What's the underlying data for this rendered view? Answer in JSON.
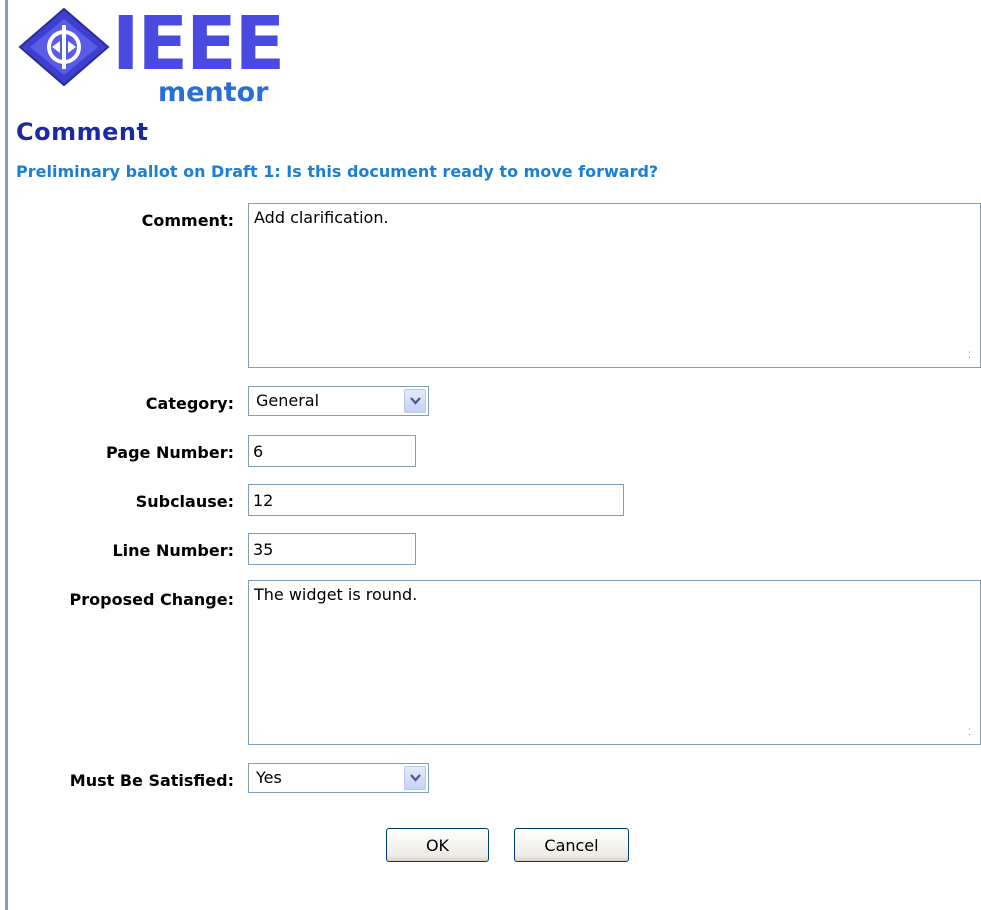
{
  "logo": {
    "brand": "IEEE",
    "product": "mentor"
  },
  "page": {
    "title": "Comment",
    "subtitle": "Preliminary ballot on Draft 1: Is this document ready to move forward?"
  },
  "form": {
    "comment": {
      "label": "Comment:",
      "value": "Add clarification."
    },
    "category": {
      "label": "Category:",
      "value": "General"
    },
    "page_number": {
      "label": "Page Number:",
      "value": "6"
    },
    "subclause": {
      "label": "Subclause:",
      "value": "12"
    },
    "line_number": {
      "label": "Line Number:",
      "value": "35"
    },
    "proposed_change": {
      "label": "Proposed Change:",
      "value": "The widget is round."
    },
    "must_be_satisfied": {
      "label": "Must Be Satisfied:",
      "value": "Yes"
    }
  },
  "buttons": {
    "ok": "OK",
    "cancel": "Cancel"
  },
  "colors": {
    "heading": "#1d2a9e",
    "subheading": "#1b7fd6",
    "field_border": "#7f9db9",
    "logo_blue": "#4a4ae0",
    "logo_product_blue": "#2a6fd4"
  }
}
